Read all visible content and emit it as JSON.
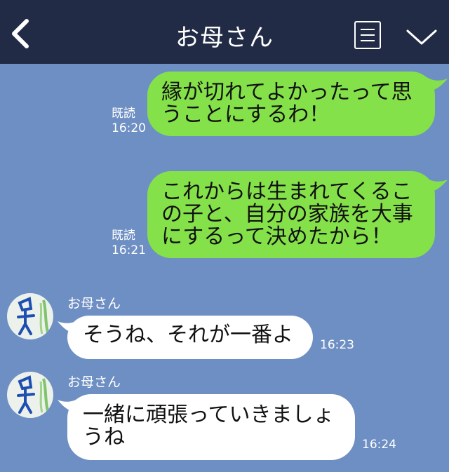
{
  "header": {
    "title": "お母さん"
  },
  "messages": [
    {
      "text_l1": "縁が切れてよかったって思",
      "text_l2": "うことにするわ！",
      "read": "既読",
      "time": "16:20"
    },
    {
      "text_l1": "これからは生まれてくるこ",
      "text_l2": "の子と、自分の家族を大事",
      "text_l3": "にするって決めたから！",
      "read": "既読",
      "time": "16:21"
    },
    {
      "sender": "お母さん",
      "text_l1": "そうね、それが一番よ",
      "time": "16:23"
    },
    {
      "sender": "お母さん",
      "text_l1": "一緒に頑張っていきましょ",
      "text_l2": "うね",
      "time": "16:24"
    }
  ]
}
